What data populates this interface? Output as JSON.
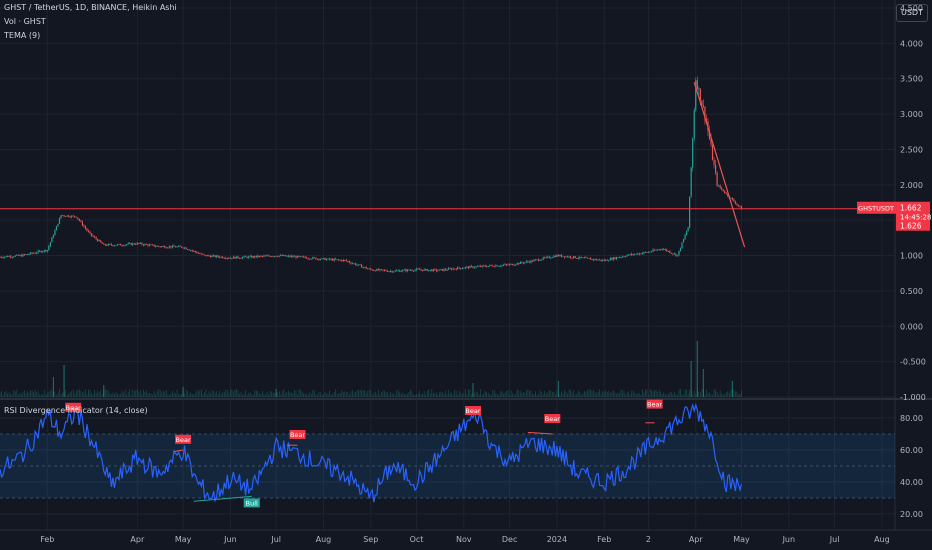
{
  "header": {
    "symbol_line": "GHST / TetherUS, 1D, BINANCE, Heikin Ashi",
    "volume_line": "Vol · GHST",
    "indicator_line": "TEMA (9)"
  },
  "currency_button": "USDT",
  "price_pane": {
    "y_ticks": [
      4.5,
      4.0,
      3.5,
      3.0,
      2.5,
      2.0,
      1.5,
      1.0,
      0.5,
      0.0,
      -0.5,
      -1.0
    ],
    "y_tick_labels": [
      "4.500",
      "4.000",
      "3.500",
      "3.000",
      "2.500",
      "2.000",
      "1.500",
      "1.000",
      "0.500",
      "0.000",
      "-0.500",
      "-1.000"
    ],
    "y_min": -1.0,
    "y_max": 4.5,
    "horizontal_line": 1.662,
    "symbol_tag": "GHSTUSDT",
    "last_price": "1.662",
    "countdown": "14:45:28",
    "second_price": "1.626",
    "trendline": [
      [
        "2024-03-31",
        3.45
      ],
      [
        "2024-05-03",
        1.12
      ]
    ],
    "colors": {
      "up": "#26a69a",
      "down": "#ef5350",
      "level": "#f23645",
      "tag": "#f23645"
    }
  },
  "x_labels": [
    "Feb",
    "Apr",
    "May",
    "Jun",
    "Jul",
    "Aug",
    "Sep",
    "Oct",
    "Nov",
    "Dec",
    "2024",
    "Feb",
    "2",
    "Apr",
    "May",
    "Jun",
    "Jul",
    "Aug"
  ],
  "x_label_positions": [
    "2023-02-01",
    "2023-04-01",
    "2023-05-01",
    "2023-06-01",
    "2023-07-01",
    "2023-08-01",
    "2023-09-01",
    "2023-10-01",
    "2023-11-01",
    "2023-12-01",
    "2024-01-01",
    "2024-02-01",
    "2024-03-01",
    "2024-04-01",
    "2024-05-01",
    "2024-06-01",
    "2024-07-01",
    "2024-08-01"
  ],
  "rsi_pane": {
    "title": "RSI Divergence Indicator (14, close)",
    "y_ticks": [
      80,
      60,
      40,
      20
    ],
    "y_tick_labels": [
      "80.00",
      "60.00",
      "40.00",
      "20.00"
    ],
    "y_min": 10,
    "y_max": 90,
    "band": [
      30,
      70
    ],
    "mid": 50,
    "line_color": "#2962ff",
    "signals": [
      {
        "type": "Bear",
        "date": "2023-02-18",
        "value": 82
      },
      {
        "type": "Bear",
        "date": "2023-05-01",
        "value": 62
      },
      {
        "type": "Bull",
        "date": "2023-06-15",
        "value": 31
      },
      {
        "type": "Bear",
        "date": "2023-07-15",
        "value": 65
      },
      {
        "type": "Bear",
        "date": "2023-11-07",
        "value": 80
      },
      {
        "type": "Bear",
        "date": "2023-12-29",
        "value": 75
      },
      {
        "type": "Bear",
        "date": "2024-03-05",
        "value": 84
      }
    ],
    "divergence_lines": [
      [
        [
          "2023-04-25",
          59
        ],
        [
          "2023-05-01",
          60
        ]
      ],
      [
        [
          "2023-05-08",
          28
        ],
        [
          "2023-06-15",
          31
        ]
      ],
      [
        [
          "2023-07-08",
          63
        ],
        [
          "2023-07-15",
          63
        ]
      ],
      [
        [
          "2023-12-13",
          71
        ],
        [
          "2023-12-29",
          70
        ]
      ],
      [
        [
          "2024-02-28",
          77
        ],
        [
          "2024-03-05",
          77
        ]
      ]
    ]
  },
  "chart_data": {
    "type": "candlestick",
    "series": [
      {
        "name": "GHST / TetherUS",
        "x": [
          "2023-01-01",
          "2023-01-15",
          "2023-02-01",
          "2023-02-10",
          "2023-02-20",
          "2023-03-01",
          "2023-03-10",
          "2023-03-20",
          "2023-04-01",
          "2023-04-15",
          "2023-05-01",
          "2023-05-15",
          "2023-06-01",
          "2023-06-15",
          "2023-07-01",
          "2023-07-15",
          "2023-08-01",
          "2023-08-15",
          "2023-09-01",
          "2023-09-15",
          "2023-10-01",
          "2023-10-15",
          "2023-11-01",
          "2023-11-15",
          "2023-12-01",
          "2023-12-15",
          "2024-01-01",
          "2024-01-15",
          "2024-02-01",
          "2024-02-15",
          "2024-03-01",
          "2024-03-10",
          "2024-03-20",
          "2024-03-27",
          "2024-04-01",
          "2024-04-08",
          "2024-04-15",
          "2024-04-22",
          "2024-05-01"
        ],
        "close": [
          0.98,
          1.0,
          1.08,
          1.57,
          1.55,
          1.3,
          1.15,
          1.15,
          1.17,
          1.13,
          1.12,
          1.0,
          0.97,
          0.98,
          1.0,
          0.98,
          0.95,
          0.93,
          0.8,
          0.78,
          0.8,
          0.79,
          0.83,
          0.85,
          0.87,
          0.92,
          1.0,
          0.97,
          0.93,
          1.0,
          1.05,
          1.1,
          1.0,
          1.4,
          3.5,
          2.9,
          2.0,
          1.85,
          1.66
        ]
      },
      {
        "name": "Vol · GHST",
        "x": [
          "2023-02-05",
          "2023-02-12",
          "2023-03-10",
          "2023-05-01",
          "2023-07-01",
          "2023-11-07",
          "2024-01-02",
          "2024-03-29",
          "2024-04-02",
          "2024-04-06",
          "2024-04-25"
        ],
        "values": [
          0.5,
          0.8,
          0.3,
          0.25,
          0.2,
          0.35,
          0.4,
          0.9,
          1.4,
          0.7,
          0.4
        ]
      },
      {
        "name": "RSI Divergence Indicator (14, close)",
        "x": [
          "2023-01-01",
          "2023-01-10",
          "2023-01-20",
          "2023-02-01",
          "2023-02-10",
          "2023-02-20",
          "2023-03-01",
          "2023-03-15",
          "2023-04-01",
          "2023-04-15",
          "2023-05-01",
          "2023-05-10",
          "2023-05-20",
          "2023-06-01",
          "2023-06-15",
          "2023-07-01",
          "2023-07-15",
          "2023-08-01",
          "2023-08-15",
          "2023-09-01",
          "2023-09-15",
          "2023-10-01",
          "2023-10-15",
          "2023-11-01",
          "2023-11-10",
          "2023-11-20",
          "2023-12-01",
          "2023-12-15",
          "2024-01-01",
          "2024-01-15",
          "2024-02-01",
          "2024-02-15",
          "2024-03-01",
          "2024-03-10",
          "2024-03-20",
          "2024-04-01",
          "2024-04-10",
          "2024-04-20",
          "2024-05-01"
        ],
        "values": [
          48,
          52,
          62,
          82,
          70,
          84,
          68,
          38,
          55,
          45,
          60,
          40,
          30,
          42,
          35,
          62,
          58,
          50,
          45,
          30,
          50,
          40,
          55,
          75,
          82,
          62,
          52,
          65,
          60,
          45,
          40,
          48,
          62,
          70,
          78,
          86,
          72,
          40,
          37
        ]
      }
    ],
    "ylim": [
      -1.0,
      4.5
    ]
  }
}
